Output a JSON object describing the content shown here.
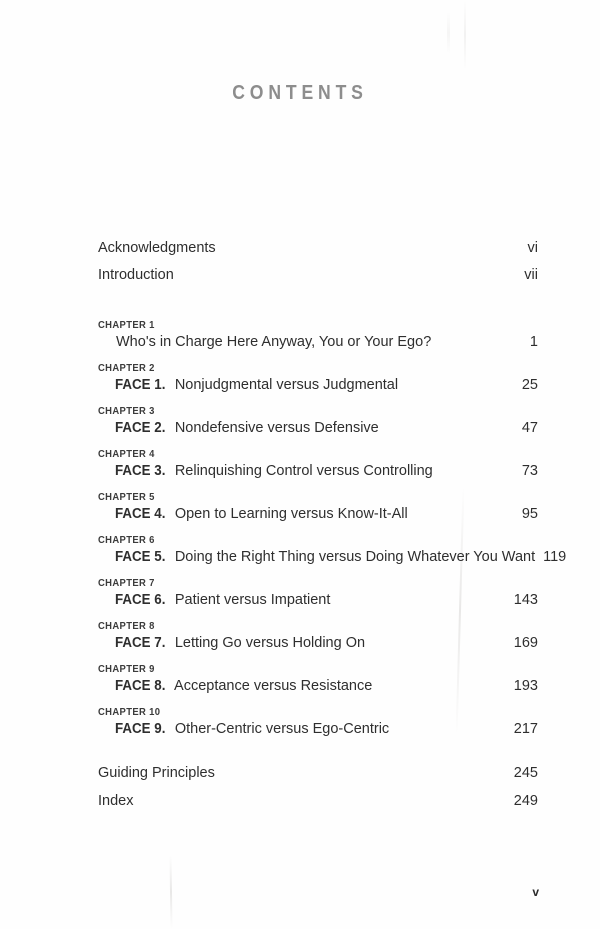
{
  "page": {
    "heading": "CONTENTS",
    "folio": "v"
  },
  "front_matter": [
    {
      "label": "Acknowledgments",
      "page": "vi"
    },
    {
      "label": "Introduction",
      "page": "vii"
    }
  ],
  "chapters": [
    {
      "chapter_label": "CHAPTER 1",
      "face_tag": "",
      "title": "Who's in Charge Here Anyway, You or Your Ego?",
      "page": "1"
    },
    {
      "chapter_label": "CHAPTER 2",
      "face_tag": "FACE 1.",
      "title": "Nonjudgmental versus Judgmental",
      "page": "25"
    },
    {
      "chapter_label": "CHAPTER 3",
      "face_tag": "FACE 2.",
      "title": "Nondefensive versus Defensive",
      "page": "47"
    },
    {
      "chapter_label": "CHAPTER 4",
      "face_tag": "FACE 3.",
      "title": "Relinquishing Control versus Controlling",
      "page": "73"
    },
    {
      "chapter_label": "CHAPTER 5",
      "face_tag": "FACE 4.",
      "title": "Open to Learning versus Know-It-All",
      "page": "95"
    },
    {
      "chapter_label": "CHAPTER 6",
      "face_tag": "FACE 5.",
      "title": "Doing the Right Thing versus Doing Whatever You Want",
      "page": "119"
    },
    {
      "chapter_label": "CHAPTER 7",
      "face_tag": "FACE 6.",
      "title": "Patient versus Impatient",
      "page": "143"
    },
    {
      "chapter_label": "CHAPTER 8",
      "face_tag": "FACE 7.",
      "title": "Letting Go versus Holding On",
      "page": "169"
    },
    {
      "chapter_label": "CHAPTER 9",
      "face_tag": "FACE 8.",
      "title": "Acceptance versus Resistance",
      "page": "193"
    },
    {
      "chapter_label": "CHAPTER 10",
      "face_tag": "FACE 9.",
      "title": "Other-Centric versus Ego-Centric",
      "page": "217"
    }
  ],
  "back_matter": [
    {
      "label": "Guiding Principles",
      "page": "245"
    },
    {
      "label": "Index",
      "page": "249"
    }
  ],
  "colors": {
    "paper": "#fefefe",
    "body_text": "#2e2e2e",
    "heading_grey": "#8d8d8d",
    "chapter_label": "#3b3b3b"
  }
}
